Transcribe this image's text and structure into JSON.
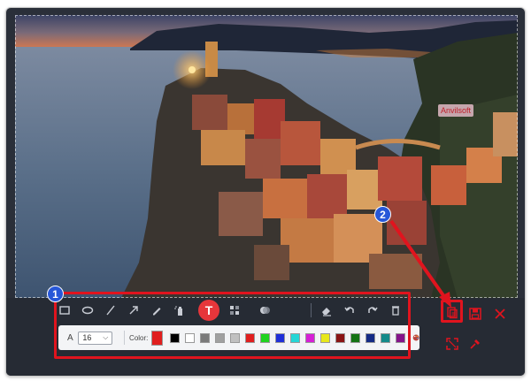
{
  "annotation": {
    "text": "Anvilsoft"
  },
  "badges": {
    "one": "1",
    "two": "2"
  },
  "toolbar": {
    "tools": [
      "rectangle",
      "ellipse",
      "line",
      "arrow",
      "pencil",
      "spray",
      "text",
      "mosaic",
      "eraser-blur"
    ],
    "edit_tools": [
      "eraser",
      "undo",
      "redo",
      "delete"
    ],
    "text_tool_glyph": "T"
  },
  "text_options": {
    "font_label": "A",
    "size_value": "16",
    "color_label": "Color:",
    "selected_color": "#e01e1e",
    "swatches": [
      "#000000",
      "#ffffff",
      "#7a7a7a",
      "#a0a0a0",
      "#c0c0c0",
      "#e01e1e",
      "#1fd31f",
      "#1f2fd8",
      "#25d6d6",
      "#d61fd6",
      "#e8e81a",
      "#8a1414",
      "#147314",
      "#142a85",
      "#148a8a",
      "#85148a"
    ]
  },
  "actions": [
    "exit-copy",
    "copy",
    "save",
    "close",
    "fullscreen",
    "pin"
  ],
  "colors": {
    "highlight": "#e0141e",
    "badge": "#2757d8",
    "active_tool": "#e6363b"
  }
}
